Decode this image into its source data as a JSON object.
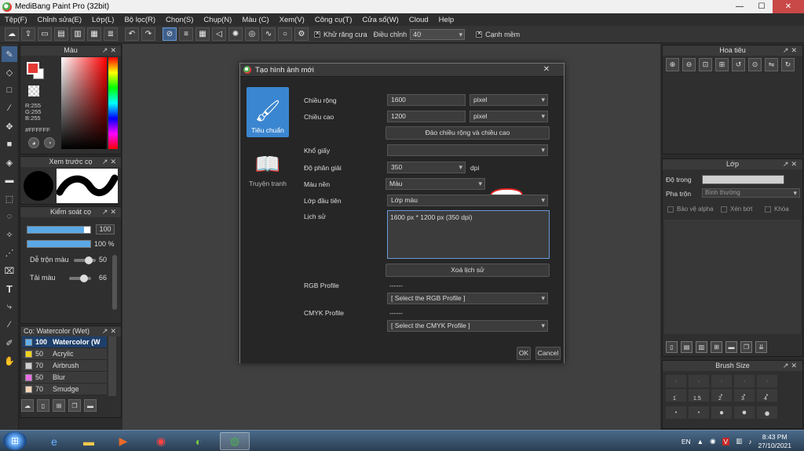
{
  "window": {
    "title": "MediBang Paint Pro (32bit)"
  },
  "menu": [
    "Tệp(F)",
    "Chỉnh sửa(E)",
    "Lớp(L)",
    "Bộ lọc(R)",
    "Chọn(S)",
    "Chụp(N)",
    "Màu (C)",
    "Xem(V)",
    "Công cụ(T)",
    "Cửa sổ(W)",
    "Cloud",
    "Help"
  ],
  "toolbar": {
    "antialias_label": "Khử răng cưa",
    "adjust_label": "Điều chỉnh",
    "adjust_value": "40",
    "sharpen_label": "Cạnh mềm"
  },
  "color_panel": {
    "title": "Màu",
    "r": "R:255",
    "g": "G:255",
    "b": "B:255",
    "hex": "#FFFFFF"
  },
  "brush_preview": {
    "title": "Xem trước cọ"
  },
  "brush_control": {
    "title": "Kiểm soát cọ",
    "size_value": "100",
    "opacity_value": "100 %",
    "mix_label": "Dễ trộn màu",
    "mix_value": "50",
    "load_label": "Tải màu",
    "load_value": "66"
  },
  "brush_list": {
    "title": "Cọ: Watercolor (Wet)",
    "items": [
      {
        "size": "100",
        "name": "Watercolor (W",
        "color": "#5fb0ea"
      },
      {
        "size": "50",
        "name": "Acrylic",
        "color": "#f2d21a"
      },
      {
        "size": "70",
        "name": "Airbrush",
        "color": "#cfcfcf"
      },
      {
        "size": "50",
        "name": "Blur",
        "color": "#e86ee8"
      },
      {
        "size": "70",
        "name": "Smudge",
        "color": "#f5d6b8"
      }
    ]
  },
  "dialog": {
    "title": "Tạo hình ảnh mới",
    "mode_standard": "Tiêu chuẩn",
    "mode_comic": "Truyện tranh",
    "width_label": "Chiều rộng",
    "width_value": "1600",
    "width_unit": "pixel",
    "height_label": "Chiều cao",
    "height_value": "1200",
    "height_unit": "pixel",
    "swap_button": "Đảo chiều rộng và chiều cao",
    "paper_label": "Khổ giấy",
    "paper_value": "",
    "resolution_label": "Độ phân giải",
    "resolution_value": "350",
    "resolution_unit": "dpi",
    "bg_label": "Màu nền",
    "bg_value": "Màu",
    "first_layer_label": "Lớp đầu tiên",
    "first_layer_value": "Lớp màu",
    "history_label": "Lịch sử",
    "history_value": "1600 px * 1200 px (350 dpi)",
    "clear_history_button": "Xoá lịch sử",
    "rgb_label": "RGB Profile",
    "rgb_text": "------",
    "rgb_select": "[ Select the RGB Profile ]",
    "cmyk_label": "CMYK Profile",
    "cmyk_text": "------",
    "cmyk_select": "[ Select the CMYK Profile ]",
    "ok_button": "OK",
    "cancel_button": "Cancel"
  },
  "navigator": {
    "title": "Hoa tiêu"
  },
  "layer_panel": {
    "title": "Lớp",
    "opacity_label": "Độ trong",
    "blend_label": "Pha trộn",
    "blend_value": "Bình thường",
    "protect_alpha": "Bảo vệ alpha",
    "clipping": "Xén bớt",
    "lock": "Khóa"
  },
  "brush_size": {
    "title": "Brush Size",
    "labels": [
      "1",
      "1.5",
      "2",
      "3",
      "4"
    ]
  },
  "taskbar": {
    "lang": "EN",
    "time": "8:43 PM",
    "date": "27/10/2021"
  }
}
